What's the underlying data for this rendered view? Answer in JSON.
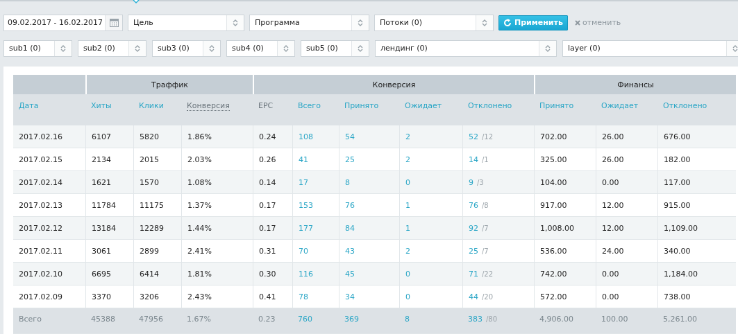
{
  "filters": {
    "date_range": "09.02.2017 - 16.02.2017",
    "row_1": [
      {
        "value": "Цель"
      },
      {
        "value": "Программа"
      },
      {
        "value": "Потоки (0)"
      }
    ],
    "apply_button": "Применить",
    "cancel_link": "отменить",
    "row_2": [
      {
        "value": "sub1 (0)",
        "kind": "narrow"
      },
      {
        "value": "sub2 (0)",
        "kind": "narrow"
      },
      {
        "value": "sub3 (0)",
        "kind": "narrow"
      },
      {
        "value": "sub4 (0)",
        "kind": "narrow"
      },
      {
        "value": "sub5 (0)",
        "kind": "narrow"
      },
      {
        "value": "лендинг (0)",
        "kind": "wide"
      },
      {
        "value": "layer (0)",
        "kind": "wide"
      }
    ]
  },
  "table": {
    "groups": [
      {
        "columns": [
          {
            "label": "Дата",
            "kind": "text"
          }
        ]
      },
      {
        "label": "Траффик",
        "columns": [
          {
            "label": "Хиты",
            "kind": "text"
          },
          {
            "label": "Клики",
            "kind": "text"
          },
          {
            "label": "Конверсия",
            "kind": "hint"
          }
        ]
      },
      {
        "label": "Конверсия",
        "columns": [
          {
            "label": "EPC",
            "kind": "plain"
          },
          {
            "label": "Всего",
            "kind": "link"
          },
          {
            "label": "Принято",
            "kind": "link"
          },
          {
            "label": "Ожидает",
            "kind": "link"
          },
          {
            "label": "Отклонено",
            "kind": "link_note"
          }
        ]
      },
      {
        "label": "Финансы",
        "columns": [
          {
            "label": "Принято",
            "kind": "text"
          },
          {
            "label": "Ожидает",
            "kind": "text"
          },
          {
            "label": "Отклонено",
            "kind": "text"
          }
        ]
      }
    ],
    "rows": [
      {
        "kind": "data",
        "cells": [
          "2017.02.16",
          "6107",
          "5820",
          "1.86%",
          "0.24",
          "108",
          "54",
          "2",
          "52",
          "702.00",
          "26.00",
          "676.00"
        ],
        "note": "/12"
      },
      {
        "kind": "data",
        "cells": [
          "2017.02.15",
          "2134",
          "2015",
          "2.03%",
          "0.26",
          "41",
          "25",
          "2",
          "14",
          "325.00",
          "26.00",
          "182.00"
        ],
        "note": "/1"
      },
      {
        "kind": "data",
        "cells": [
          "2017.02.14",
          "1621",
          "1570",
          "1.08%",
          "0.14",
          "17",
          "8",
          "0",
          "9",
          "104.00",
          "0.00",
          "117.00"
        ],
        "note": "/3"
      },
      {
        "kind": "data",
        "cells": [
          "2017.02.13",
          "11784",
          "11175",
          "1.37%",
          "0.17",
          "153",
          "76",
          "1",
          "76",
          "917.00",
          "12.00",
          "915.00"
        ],
        "note": "/8"
      },
      {
        "kind": "data",
        "cells": [
          "2017.02.12",
          "13184",
          "12289",
          "1.44%",
          "0.17",
          "177",
          "84",
          "1",
          "92",
          "1,008.00",
          "12.00",
          "1,109.00"
        ],
        "note": "/7"
      },
      {
        "kind": "data",
        "cells": [
          "2017.02.11",
          "3061",
          "2899",
          "2.41%",
          "0.31",
          "70",
          "43",
          "2",
          "25",
          "536.00",
          "24.00",
          "340.00"
        ],
        "note": "/7"
      },
      {
        "kind": "data",
        "cells": [
          "2017.02.10",
          "6695",
          "6414",
          "1.81%",
          "0.30",
          "116",
          "45",
          "0",
          "71",
          "742.00",
          "0.00",
          "1,184.00"
        ],
        "note": "/22"
      },
      {
        "kind": "data",
        "cells": [
          "2017.02.09",
          "3370",
          "3206",
          "2.43%",
          "0.41",
          "78",
          "34",
          "0",
          "44",
          "572.00",
          "0.00",
          "738.00"
        ],
        "note": "/20"
      },
      {
        "kind": "total",
        "cells": [
          "Всего",
          "45388",
          "47956",
          "1.67%",
          "0.23",
          "760",
          "369",
          "8",
          "383",
          "4,906.00",
          "100.00",
          "5,261.00"
        ],
        "note": "/80"
      }
    ]
  }
}
